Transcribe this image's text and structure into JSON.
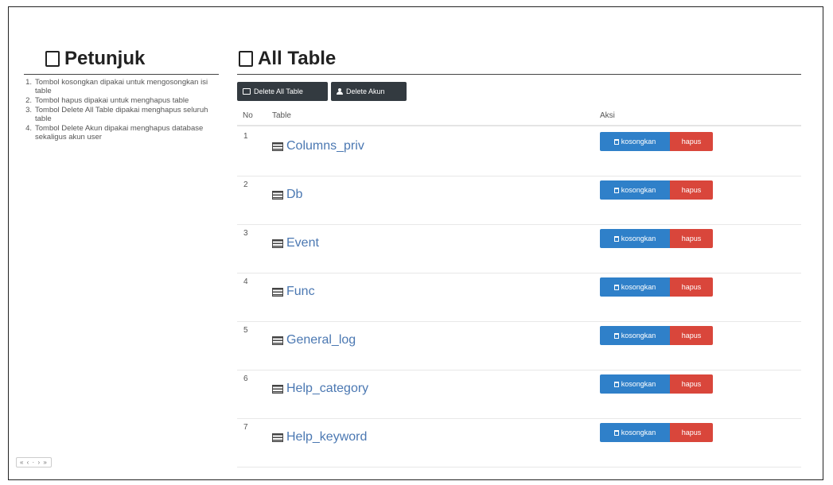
{
  "left": {
    "title": "Petunjuk",
    "items": [
      {
        "num": "1.",
        "text": "Tombol kosongkan dipakai untuk mengosongkan isi table"
      },
      {
        "num": "2.",
        "text": "Tombol hapus dipakai untuk menghapus table"
      },
      {
        "num": "3.",
        "text": "Tombol Delete All Table dipakai menghapus seluruh table"
      },
      {
        "num": "4.",
        "text": "Tombol Delete Akun dipakai menghapus database sekaligus akun user"
      }
    ]
  },
  "main": {
    "title": "All Table",
    "buttons": {
      "delete_all_table": "Delete All Table",
      "delete_akun": "Delete Akun"
    },
    "columns": {
      "no": "No",
      "table": "Table",
      "aksi": "Aksi"
    },
    "rows": [
      {
        "no": "1",
        "name": "Columns_priv"
      },
      {
        "no": "2",
        "name": "Db"
      },
      {
        "no": "3",
        "name": "Event"
      },
      {
        "no": "4",
        "name": "Func"
      },
      {
        "no": "5",
        "name": "General_log"
      },
      {
        "no": "6",
        "name": "Help_category"
      },
      {
        "no": "7",
        "name": "Help_keyword"
      }
    ],
    "action_labels": {
      "kosongkan": "kosongkan",
      "hapus": "hapus"
    }
  },
  "pager": {
    "text": "« ‹ · › »"
  },
  "colors": {
    "dark_button": "#333a40",
    "primary": "#2f80c9",
    "danger": "#d9463b",
    "link": "#4b78b2"
  }
}
